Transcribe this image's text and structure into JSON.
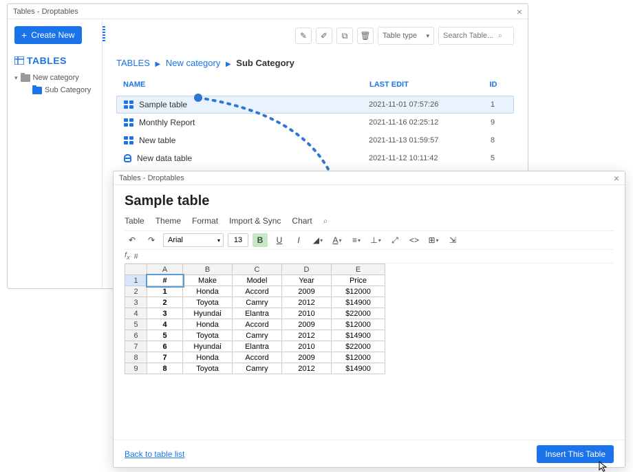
{
  "window1": {
    "title": "Tables - Droptables",
    "create_label": "Create New",
    "tables_header": "TABLES",
    "tree": [
      {
        "label": "New category",
        "active": false
      },
      {
        "label": "Sub Category",
        "active": true
      }
    ],
    "type_select": "Table type",
    "search_placeholder": "Search Table...",
    "breadcrumb": [
      "TABLES",
      "New category",
      "Sub Category"
    ],
    "columns": {
      "name": "NAME",
      "edit": "LAST EDIT",
      "id": "ID"
    },
    "rows": [
      {
        "name": "Sample table",
        "edit": "2021-11-01 07:57:26",
        "id": "1",
        "icon": "grid",
        "active": true
      },
      {
        "name": "Monthly Report",
        "edit": "2021-11-16 02:25:12",
        "id": "9",
        "icon": "grid",
        "active": false
      },
      {
        "name": "New table",
        "edit": "2021-11-13 01:59:57",
        "id": "8",
        "icon": "grid",
        "active": false
      },
      {
        "name": "New data table",
        "edit": "2021-11-12 10:11:42",
        "id": "5",
        "icon": "db",
        "active": false
      }
    ]
  },
  "window2": {
    "title": "Tables - Droptables",
    "heading": "Sample table",
    "menu": [
      "Table",
      "Theme",
      "Format",
      "Import & Sync",
      "Chart"
    ],
    "font": "Arial",
    "fontsize": "13",
    "fx": "#",
    "colheaders": [
      "A",
      "B",
      "C",
      "D",
      "E"
    ],
    "header_row": [
      "#",
      "Make",
      "Model",
      "Year",
      "Price"
    ],
    "data": [
      [
        "1",
        "Honda",
        "Accord",
        "2009",
        "$12000"
      ],
      [
        "2",
        "Toyota",
        "Camry",
        "2012",
        "$14900"
      ],
      [
        "3",
        "Hyundai",
        "Elantra",
        "2010",
        "$22000"
      ],
      [
        "4",
        "Honda",
        "Accord",
        "2009",
        "$12000"
      ],
      [
        "5",
        "Toyota",
        "Camry",
        "2012",
        "$14900"
      ],
      [
        "6",
        "Hyundai",
        "Elantra",
        "2010",
        "$22000"
      ],
      [
        "7",
        "Honda",
        "Accord",
        "2009",
        "$12000"
      ],
      [
        "8",
        "Toyota",
        "Camry",
        "2012",
        "$14900"
      ]
    ],
    "back_link": "Back to table list",
    "insert_label": "Insert This Table"
  }
}
